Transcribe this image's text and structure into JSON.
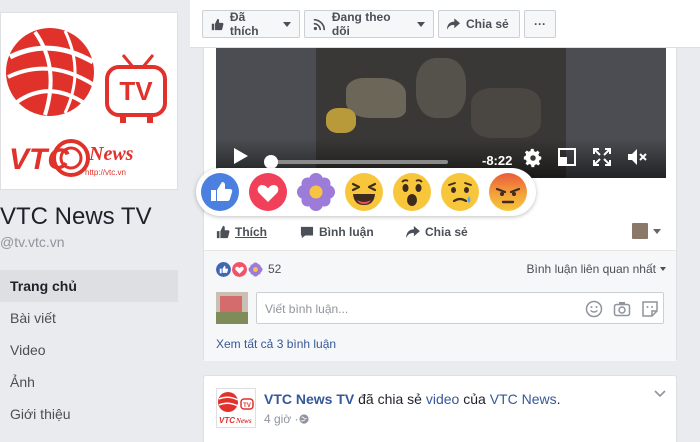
{
  "page": {
    "name": "VTC News TV",
    "handle": "@tv.vtc.vn",
    "logo_text": "VTC News",
    "logo_url": "http://vtc.vn",
    "logo_tv": "TV"
  },
  "left_nav": {
    "items": [
      {
        "label": "Trang chủ",
        "active": true
      },
      {
        "label": "Bài viết",
        "active": false
      },
      {
        "label": "Video",
        "active": false
      },
      {
        "label": "Ảnh",
        "active": false
      },
      {
        "label": "Giới thiệu",
        "active": false
      }
    ]
  },
  "action_bar": {
    "like_label": "Đã thích",
    "follow_label": "Đang theo dõi",
    "share_label": "Chia sẻ",
    "more_label": "···"
  },
  "video": {
    "time_remaining": "-8:22",
    "progress": 0.02
  },
  "reactions": [
    "like-reaction",
    "love-reaction",
    "thankful-reaction",
    "haha-reaction",
    "wow-reaction",
    "sad-reaction",
    "angry-reaction"
  ],
  "post_actions": {
    "like": "Thích",
    "comment": "Bình luận",
    "share": "Chia sẻ"
  },
  "engagement": {
    "reaction_count": "52",
    "sort_label": "Bình luận liên quan nhất"
  },
  "comment_box": {
    "placeholder": "Viết bình luận..."
  },
  "see_all_comments": "Xem tất cả 3 bình luận",
  "post2": {
    "author": "VTC News TV",
    "action_text": " đã chia sẻ ",
    "object": "video",
    "of_text": " của ",
    "source": "VTC News",
    "end": ".",
    "time": "4 giờ · "
  },
  "colors": {
    "fb_blue": "#4267b2",
    "link_blue": "#365899",
    "vtc_red": "#e0312b"
  }
}
